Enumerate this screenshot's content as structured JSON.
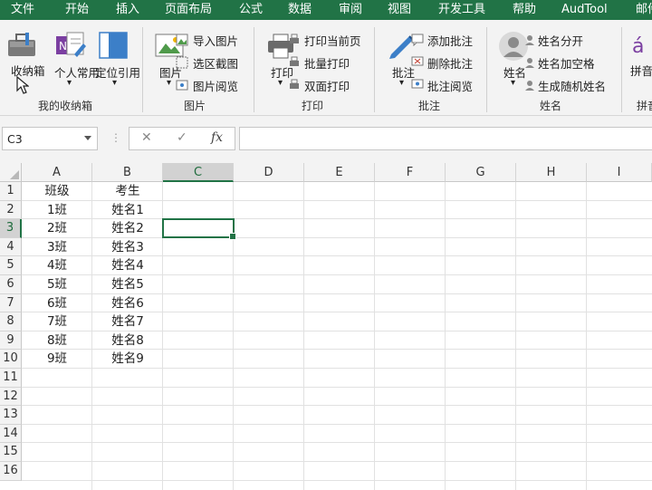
{
  "menu": [
    "文件",
    "开始",
    "插入",
    "页面布局",
    "公式",
    "数据",
    "审阅",
    "视图",
    "开发工具",
    "帮助",
    "AudTool",
    "邮件"
  ],
  "ribbon": {
    "groups": [
      {
        "label": "我的收纳箱",
        "buttons": [
          "收纳箱",
          "个人常用",
          "定位引用"
        ]
      },
      {
        "label": "图片",
        "buttons": [
          "图片",
          "导入图片",
          "选区截图",
          "图片阅览"
        ]
      },
      {
        "label": "打印",
        "buttons": [
          "打印",
          "打印当前页",
          "批量打印",
          "双面打印"
        ]
      },
      {
        "label": "批注",
        "buttons": [
          "批注",
          "添加批注",
          "删除批注",
          "批注阅览"
        ]
      },
      {
        "label": "姓名",
        "buttons": [
          "姓名",
          "姓名分开",
          "姓名加空格",
          "生成随机姓名"
        ]
      },
      {
        "label": "拼音",
        "buttons": [
          "拼音画"
        ]
      }
    ]
  },
  "namebox": {
    "value": "C3"
  },
  "formula": {
    "cancel": "✕",
    "enter": "✓",
    "fx": "fx",
    "value": ""
  },
  "columns": [
    "A",
    "B",
    "C",
    "D",
    "E",
    "F",
    "G",
    "H",
    "I"
  ],
  "rows": [
    "1",
    "2",
    "3",
    "4",
    "5",
    "6",
    "7",
    "8",
    "9",
    "10",
    "11",
    "12",
    "13",
    "14",
    "15",
    "16"
  ],
  "cells": {
    "A": [
      "班级",
      "1班",
      "2班",
      "3班",
      "4班",
      "5班",
      "6班",
      "7班",
      "8班",
      "9班"
    ],
    "B": [
      "考生",
      "姓名1",
      "姓名2",
      "姓名3",
      "姓名4",
      "姓名5",
      "姓名6",
      "姓名7",
      "姓名8",
      "姓名9"
    ]
  },
  "selection": {
    "cell": "C3",
    "column": "C",
    "row": "3"
  },
  "colors": {
    "accent": "#217346",
    "header_bg": "#f3f3f3",
    "selected_header": "#d2d2d2"
  }
}
